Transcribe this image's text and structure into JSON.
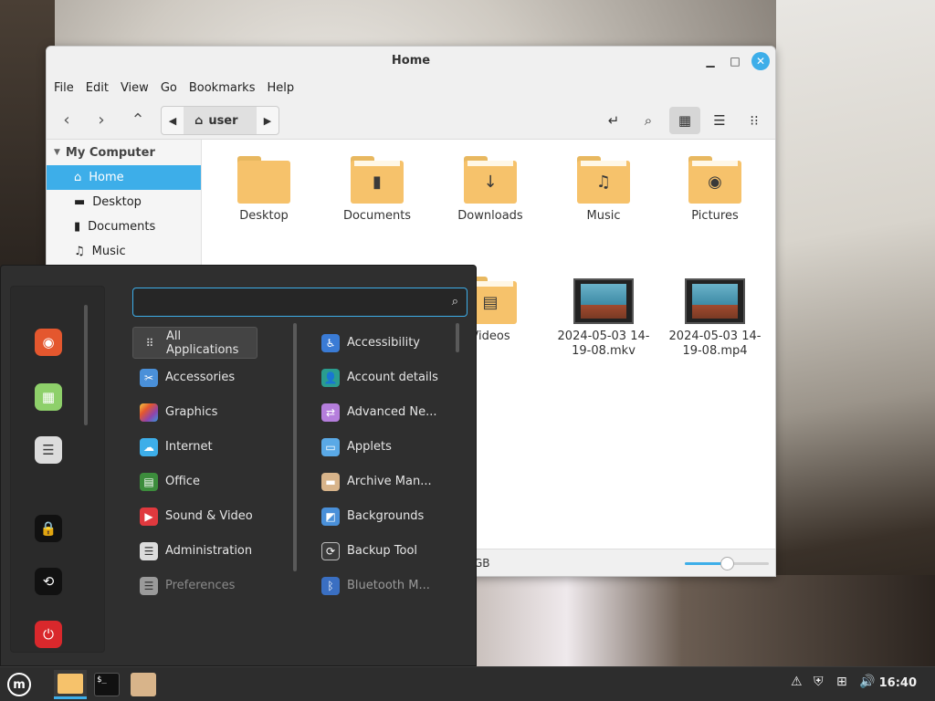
{
  "file_manager": {
    "title": "Home",
    "menu": [
      "File",
      "Edit",
      "View",
      "Go",
      "Bookmarks",
      "Help"
    ],
    "breadcrumb_current": "user",
    "sidebar_heading": "My Computer",
    "sidebar_items": [
      "Home",
      "Desktop",
      "Documents",
      "Music"
    ],
    "files": [
      {
        "name": "Desktop",
        "kind": "folder",
        "glyph": ""
      },
      {
        "name": "Documents",
        "kind": "folder",
        "glyph": "document-icon"
      },
      {
        "name": "Downloads",
        "kind": "folder",
        "glyph": "download-icon"
      },
      {
        "name": "Music",
        "kind": "folder",
        "glyph": "music-icon"
      },
      {
        "name": "Pictures",
        "kind": "folder",
        "glyph": "camera-icon"
      },
      {
        "name": "Videos",
        "kind": "folder",
        "glyph": "film-icon"
      },
      {
        "name": "2024-05-03 14-19-08.mkv",
        "kind": "video"
      },
      {
        "name": "2024-05-03 14-19-08.mp4",
        "kind": "video"
      }
    ],
    "status_text": "GB",
    "zoom_level": 0.5
  },
  "app_menu": {
    "search_placeholder": "",
    "categories": [
      "All Applications",
      "Accessories",
      "Graphics",
      "Internet",
      "Office",
      "Sound & Video",
      "Administration",
      "Preferences"
    ],
    "apps": [
      "Accessibility",
      "Account details",
      "Advanced Ne...",
      "Applets",
      "Archive Man...",
      "Backgrounds",
      "Backup Tool",
      "Bluetooth M..."
    ]
  },
  "taskbar": {
    "clock": "16:40"
  },
  "colors": {
    "accent": "#3daee9",
    "folder": "#f6c26b",
    "menu_bg": "#2f2f2f"
  }
}
